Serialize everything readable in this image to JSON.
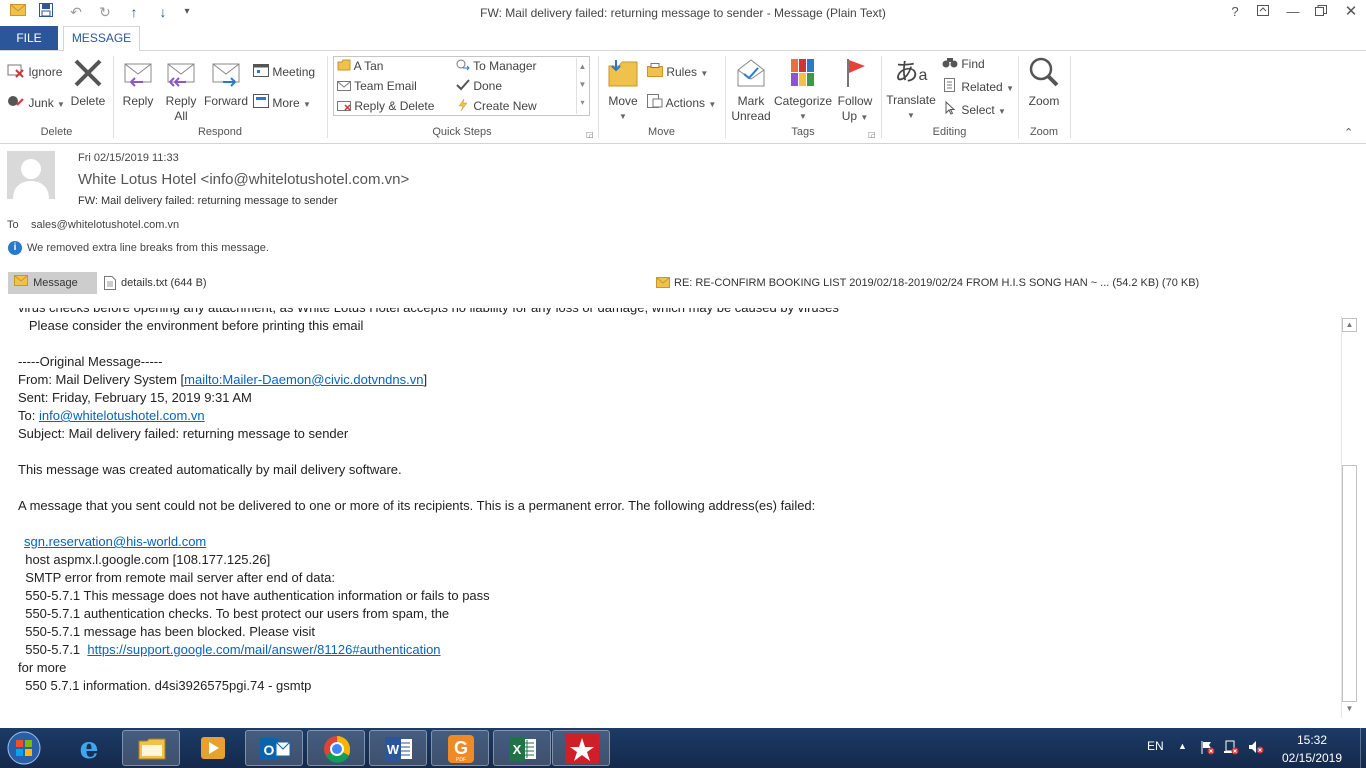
{
  "window": {
    "title": "FW: Mail delivery failed: returning message to sender - Message (Plain Text)",
    "help": "?"
  },
  "tabs": {
    "file": "FILE",
    "message": "MESSAGE"
  },
  "ribbon": {
    "delete_group": {
      "label": "Delete",
      "ignore": "Ignore",
      "junk": "Junk",
      "delete": "Delete"
    },
    "respond_group": {
      "label": "Respond",
      "reply": "Reply",
      "reply_all_1": "Reply",
      "reply_all_2": "All",
      "forward": "Forward",
      "meeting": "Meeting",
      "more": "More"
    },
    "quick_steps": {
      "label": "Quick Steps",
      "items": [
        "A Tan",
        "Team Email",
        "Reply & Delete",
        "To Manager",
        "Done",
        "Create New"
      ]
    },
    "move_group": {
      "label": "Move",
      "move": "Move",
      "rules": "Rules",
      "actions": "Actions"
    },
    "tags_group": {
      "label": "Tags",
      "mark_unread_1": "Mark",
      "mark_unread_2": "Unread",
      "categorize": "Categorize",
      "follow_up_1": "Follow",
      "follow_up_2": "Up"
    },
    "editing_group": {
      "label": "Editing",
      "translate": "Translate",
      "find": "Find",
      "related": "Related",
      "select": "Select"
    },
    "zoom_group": {
      "label": "Zoom",
      "zoom": "Zoom"
    }
  },
  "message": {
    "date": "Fri 02/15/2019 11:33",
    "from": "White Lotus Hotel <info@whitelotushotel.com.vn>",
    "subject": "FW: Mail delivery failed: returning message to sender",
    "to_label": "To",
    "to": "sales@whitelotushotel.com.vn",
    "info_notice": "We removed extra line breaks from this message."
  },
  "attachments": {
    "message_tab": "Message",
    "file1": "details.txt (644 B)",
    "file2": "RE: RE-CONFIRM BOOKING LIST 2019/02/18-2019/02/24 FROM H.I.S SONG HAN ~ ... (54.2 KB) (70 KB)"
  },
  "body": {
    "line_cut": "virus checks before opening any attachment, as White Lotus Hotel accepts no liability for any loss or damage, which may be caused by viruses",
    "line_env": "   Please consider the environment before printing this email",
    "orig_header": "-----Original Message-----",
    "from_prefix": "From: Mail Delivery System [",
    "from_link": "mailto:Mailer-Daemon@civic.dotvndns.vn",
    "from_suffix": "]",
    "sent": "Sent: Friday, February 15, 2019 9:31 AM",
    "to_prefix": "To: ",
    "to_link": "info@whitelotushotel.com.vn",
    "subject": "Subject: Mail delivery failed: returning message to sender",
    "auto": "This message was created automatically by mail delivery software.",
    "perm": "A message that you sent could not be delivered to one or more of its recipients. This is a permanent error. The following address(es) failed:",
    "failed_addr": "sgn.reservation@his-world.com",
    "host": "  host aspmx.l.google.com [108.177.125.26]",
    "smtp": "  SMTP error from remote mail server after end of data:",
    "e1": "  550-5.7.1 This message does not have authentication information or fails to pass",
    "e2": "  550-5.7.1 authentication checks. To best protect our users from spam, the",
    "e3": "  550-5.7.1 message has been blocked. Please visit",
    "e4_prefix": "  550-5.7.1  ",
    "e4_link": "https://support.google.com/mail/answer/81126#authentication",
    "for_more": "for more",
    "e5": "  550 5.7.1 information. d4si3926575pgi.74 - gsmtp"
  },
  "taskbar": {
    "lang": "EN",
    "time": "15:32",
    "date": "02/15/2019"
  },
  "colors": {
    "accent": "#2b579a",
    "link": "#0563c1",
    "taskbar": "#1c3b66"
  }
}
